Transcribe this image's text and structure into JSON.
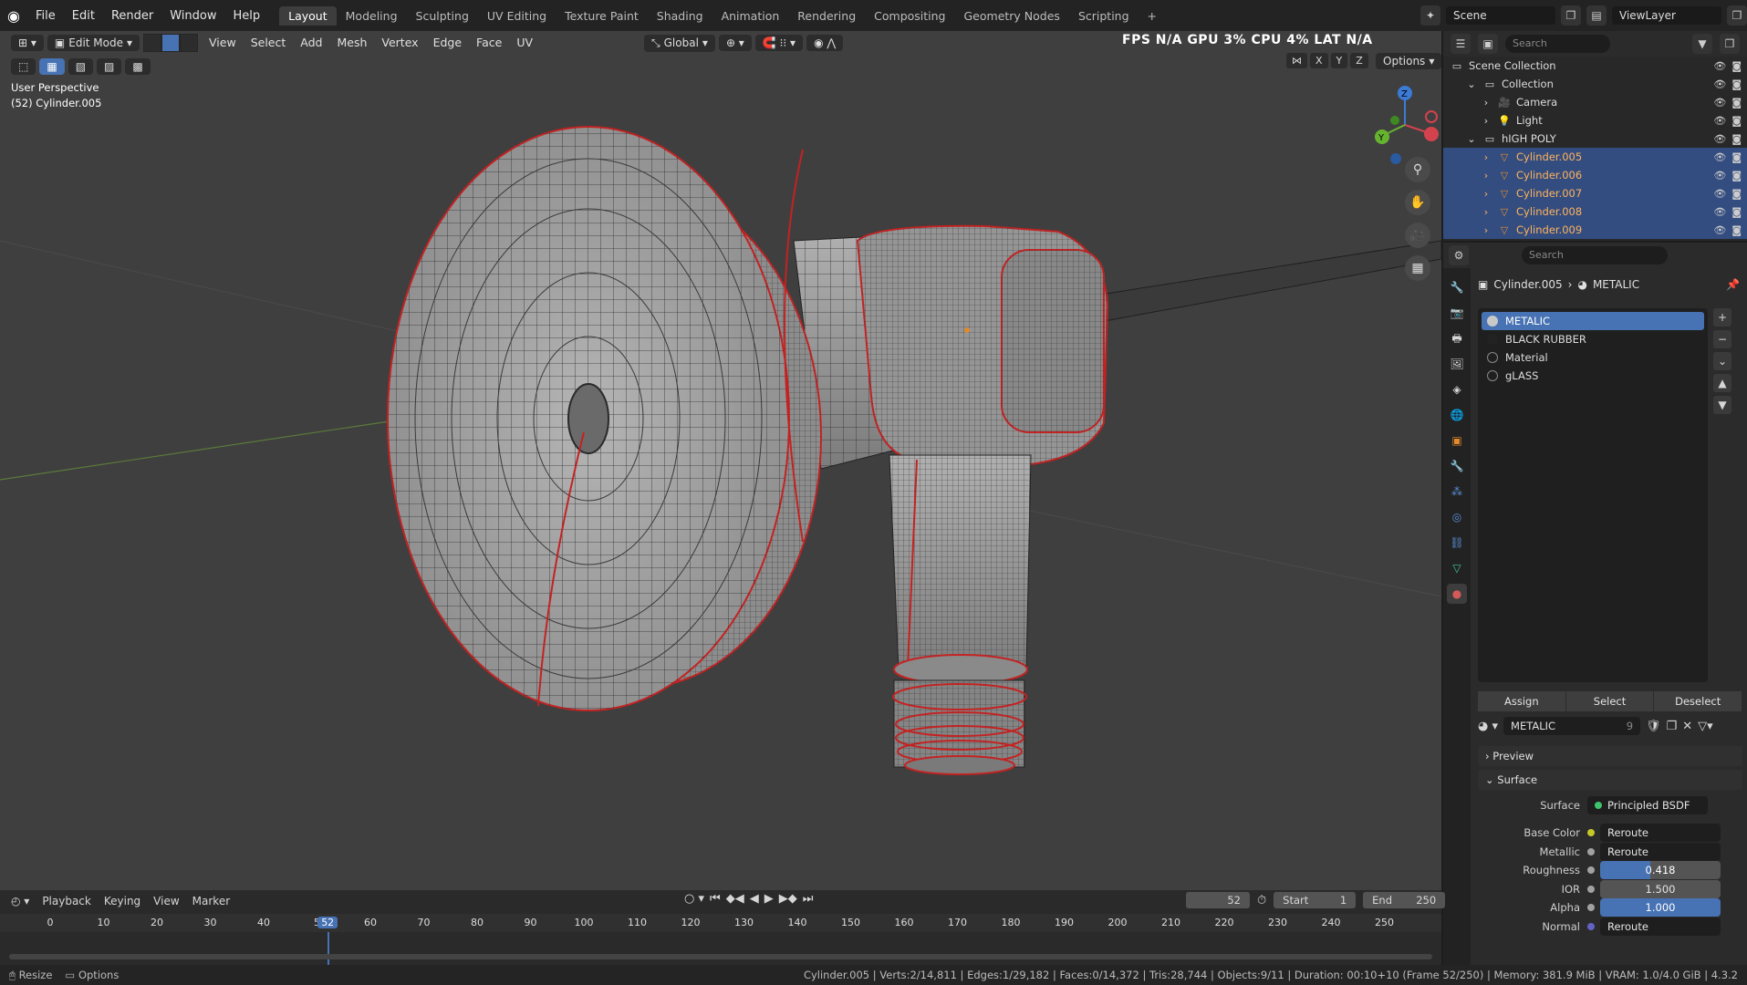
{
  "app": {
    "menu": [
      "File",
      "Edit",
      "Render",
      "Window",
      "Help"
    ],
    "workspaces": [
      "Layout",
      "Modeling",
      "Sculpting",
      "UV Editing",
      "Texture Paint",
      "Shading",
      "Animation",
      "Rendering",
      "Compositing",
      "Geometry Nodes",
      "Scripting"
    ],
    "active_workspace": "Layout",
    "scene": "Scene",
    "view_layer": "ViewLayer",
    "add_tab": "+"
  },
  "viewport": {
    "mode": "Edit Mode",
    "menus": [
      "View",
      "Select",
      "Add",
      "Mesh",
      "Vertex",
      "Edge",
      "Face",
      "UV"
    ],
    "orientation": "Global",
    "options": "Options",
    "perspective": "User Perspective",
    "active_object": "(52) Cylinder.005",
    "overlay_stats": "FPS  N/A  GPU  3%  CPU  4%  LAT  N/A",
    "mirror_axes": [
      "X",
      "Y",
      "Z"
    ]
  },
  "outliner": {
    "search_placeholder": "Search",
    "rows": [
      {
        "label": "Scene Collection",
        "indent": 0,
        "icon": "collection-icon",
        "selected": false
      },
      {
        "label": "Collection",
        "indent": 1,
        "icon": "collection-icon",
        "selected": false
      },
      {
        "label": "Camera",
        "indent": 2,
        "icon": "camera-icon",
        "selected": false
      },
      {
        "label": "Light",
        "indent": 2,
        "icon": "light-icon",
        "selected": false
      },
      {
        "label": "hIGH POLY",
        "indent": 1,
        "icon": "collection-icon",
        "selected": false
      },
      {
        "label": "Cylinder.005",
        "indent": 2,
        "icon": "mesh-icon",
        "selected": true
      },
      {
        "label": "Cylinder.006",
        "indent": 2,
        "icon": "mesh-icon",
        "selected": true
      },
      {
        "label": "Cylinder.007",
        "indent": 2,
        "icon": "mesh-icon",
        "selected": true
      },
      {
        "label": "Cylinder.008",
        "indent": 2,
        "icon": "mesh-icon",
        "selected": true
      },
      {
        "label": "Cylinder.009",
        "indent": 2,
        "icon": "mesh-icon",
        "selected": true
      }
    ]
  },
  "properties": {
    "search_placeholder": "Search",
    "breadcrumb_object": "Cylinder.005",
    "breadcrumb_material": "METALIC",
    "material_slots": [
      {
        "label": "METALIC",
        "selected": true,
        "color": "#c8c8c8"
      },
      {
        "label": "BLACK RUBBER",
        "selected": false,
        "color": "#222222"
      },
      {
        "label": "Material",
        "selected": false,
        "color": ""
      },
      {
        "label": "gLASS",
        "selected": false,
        "color": ""
      }
    ],
    "assign": "Assign",
    "select": "Select",
    "deselect": "Deselect",
    "material_name": "METALIC",
    "material_users": "9",
    "preview": "Preview",
    "surface_panel": "Surface",
    "surface_label": "Surface",
    "surface_value": "Principled BSDF",
    "rows": [
      {
        "label": "Base Color",
        "value": "Reroute",
        "kind": "link",
        "dot": "#c7c729"
      },
      {
        "label": "Metallic",
        "value": "Reroute",
        "kind": "link",
        "dot": "#a1a1a1"
      },
      {
        "label": "Roughness",
        "value": "0.418",
        "kind": "slider",
        "fraction": 0.418,
        "dot": "#a1a1a1"
      },
      {
        "label": "IOR",
        "value": "1.500",
        "kind": "num",
        "dot": "#a1a1a1"
      },
      {
        "label": "Alpha",
        "value": "1.000",
        "kind": "slider",
        "fraction": 1.0,
        "dot": "#a1a1a1"
      },
      {
        "label": "Normal",
        "value": "Reroute",
        "kind": "link",
        "dot": "#6363c7"
      }
    ]
  },
  "timeline": {
    "menus": [
      "Playback",
      "Keying",
      "View",
      "Marker"
    ],
    "current_frame": "52",
    "start_label": "Start",
    "start": "1",
    "end_label": "End",
    "end": "250",
    "ticks": [
      "0",
      "10",
      "20",
      "30",
      "40",
      "5",
      "60",
      "70",
      "80",
      "90",
      "100",
      "110",
      "120",
      "130",
      "140",
      "150",
      "160",
      "170",
      "180",
      "190",
      "200",
      "210",
      "220",
      "230",
      "240",
      "250"
    ]
  },
  "status": {
    "left_1": "Resize",
    "left_2": "Options",
    "right": "Cylinder.005 | Verts:2/14,811 | Edges:1/29,182 | Faces:0/14,372 | Tris:28,744 | Objects:9/11 | Duration: 00:10+10 (Frame 52/250) | Memory: 381.9 MiB | VRAM: 1.0/4.0 GiB | 4.3.2"
  },
  "colors": {
    "accent": "#4772b3",
    "selected_object_text": "#ffb35c",
    "seam": "#d62020",
    "mesh_surface": "#9c9c9c"
  }
}
